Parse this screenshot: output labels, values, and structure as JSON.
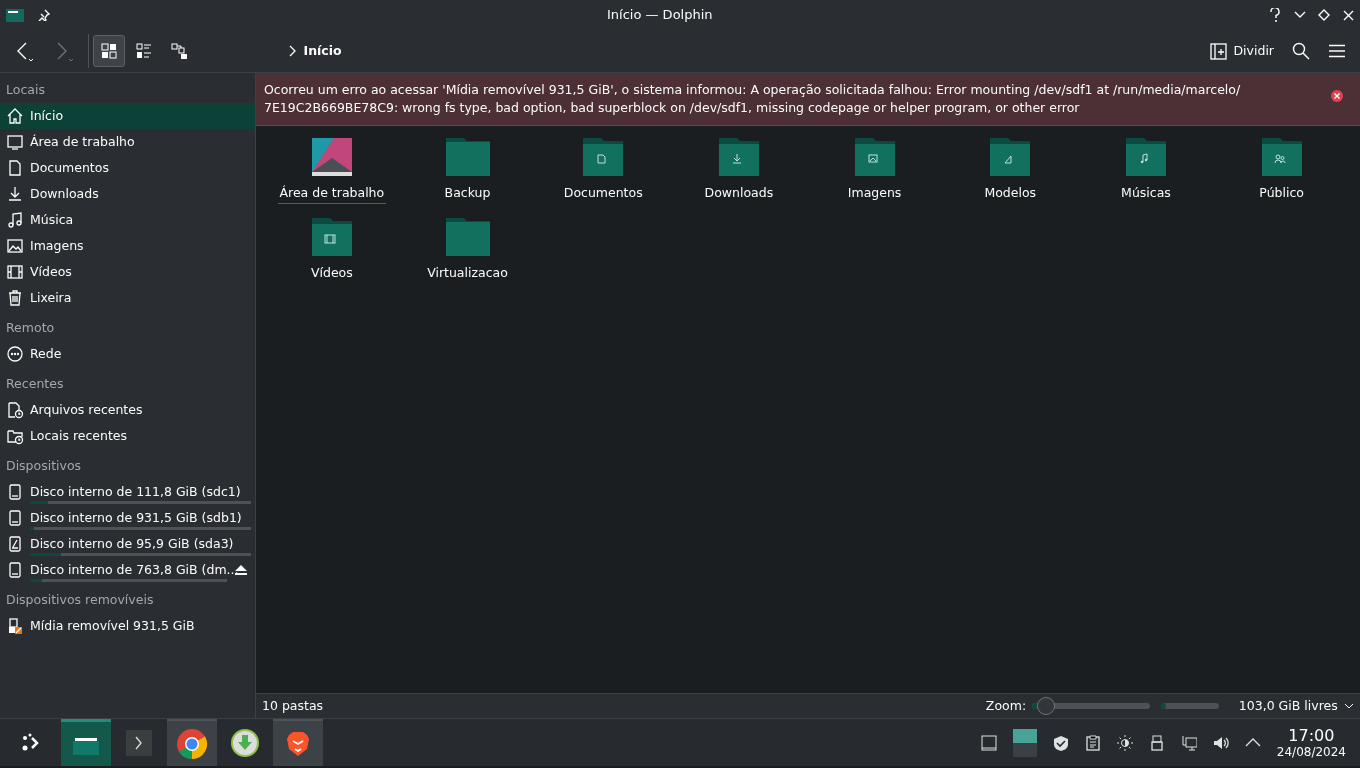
{
  "window": {
    "title": "Início — Dolphin"
  },
  "toolbar": {
    "view_modes": [
      {
        "kind": "icons",
        "selected": true
      },
      {
        "kind": "details",
        "selected": false
      },
      {
        "kind": "tree",
        "selected": false
      }
    ],
    "breadcrumb": "Início",
    "split_button": "Dividir"
  },
  "sidebar": {
    "sections": [
      {
        "title": "Locais",
        "items": [
          {
            "kind": "home",
            "label": "Início",
            "selected": true
          },
          {
            "kind": "desktop",
            "label": "Área de trabalho",
            "selected": false
          },
          {
            "kind": "document",
            "label": "Documentos",
            "selected": false
          },
          {
            "kind": "download",
            "label": "Downloads",
            "selected": false
          },
          {
            "kind": "music",
            "label": "Música",
            "selected": false
          },
          {
            "kind": "image",
            "label": "Imagens",
            "selected": false
          },
          {
            "kind": "video",
            "label": "Vídeos",
            "selected": false
          },
          {
            "kind": "trash",
            "label": "Lixeira",
            "selected": false
          }
        ]
      },
      {
        "title": "Remoto",
        "items": [
          {
            "kind": "network",
            "label": "Rede",
            "selected": false
          }
        ]
      },
      {
        "title": "Recentes",
        "items": [
          {
            "kind": "recent-file",
            "label": "Arquivos recentes",
            "selected": false
          },
          {
            "kind": "recent-folder",
            "label": "Locais recentes",
            "selected": false
          }
        ]
      },
      {
        "title": "Dispositivos",
        "items": [
          {
            "kind": "disk",
            "label": "Disco interno de 111,8 GiB (sdc1)",
            "selected": false,
            "level": 0.08,
            "eject": false
          },
          {
            "kind": "disk",
            "label": "Disco interno de 931,5 GiB (sdb1)",
            "selected": false,
            "level": 0.02,
            "eject": false
          },
          {
            "kind": "disk-system",
            "label": "Disco interno de 95,9 GiB (sda3)",
            "selected": false,
            "level": 0.14,
            "eject": false
          },
          {
            "kind": "disk",
            "label": "Disco interno de 763,8 GiB (dm...",
            "selected": false,
            "level": 0.06,
            "eject": true
          }
        ]
      },
      {
        "title": "Dispositivos removíveis",
        "items": [
          {
            "kind": "usb",
            "label": "Mídia removível 931,5 GiB",
            "selected": false
          }
        ]
      }
    ]
  },
  "error": {
    "message": "Ocorreu um erro ao acessar 'Mídia removível 931,5 GiB', o sistema informou: A operação solicitada falhou: Error mounting /dev/sdf1 at /run/media/marcelo/ 7E19C2B669BE78C9: wrong fs type, bad option, bad superblock on /dev/sdf1, missing codepage or helper program, or other error"
  },
  "folders": [
    {
      "kind": "desktop",
      "name": "Área de trabalho",
      "focused": true
    },
    {
      "kind": "plain",
      "name": "Backup",
      "focused": false
    },
    {
      "kind": "document",
      "name": "Documentos",
      "focused": false
    },
    {
      "kind": "download",
      "name": "Downloads",
      "focused": false
    },
    {
      "kind": "image",
      "name": "Imagens",
      "focused": false
    },
    {
      "kind": "template",
      "name": "Modelos",
      "focused": false
    },
    {
      "kind": "music",
      "name": "Músicas",
      "focused": false
    },
    {
      "kind": "public",
      "name": "Público",
      "focused": false
    },
    {
      "kind": "video",
      "name": "Vídeos",
      "focused": false
    },
    {
      "kind": "plain",
      "name": "Virtualizacao",
      "focused": false
    }
  ],
  "status_bar": {
    "count": "10 pastas",
    "zoom_label": "Zoom:",
    "zoom": {
      "level": 0.05
    },
    "free_space": {
      "level": 0.09
    },
    "free_text": "103,0 GiB livres"
  },
  "taskbar": {
    "tasks": [
      {
        "kind": "launcher",
        "active": false,
        "open": false
      },
      {
        "kind": "files",
        "active": true,
        "open": true
      },
      {
        "kind": "terminal",
        "active": false,
        "open": false
      },
      {
        "kind": "chrome",
        "active": false,
        "open": true
      },
      {
        "kind": "downloader",
        "active": false,
        "open": false
      },
      {
        "kind": "brave",
        "active": false,
        "open": true
      }
    ],
    "time": "17:00",
    "date": "24/08/2024"
  }
}
